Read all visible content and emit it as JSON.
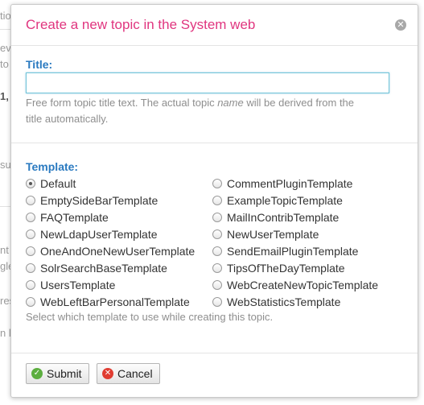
{
  "background": {
    "fragments": [
      "tio",
      "eve",
      "to",
      "1,",
      "sue",
      "nt",
      "gle",
      "res",
      "n li"
    ]
  },
  "dialog": {
    "title": "Create a new topic in the System web",
    "close_icon": "close-icon",
    "title_label": "Title:",
    "title_value": "",
    "title_hint_1": "Free form topic title text. The actual topic ",
    "title_hint_name": "name",
    "title_hint_2": " will be derived from the",
    "title_hint_3": "title automatically.",
    "template_label": "Template:",
    "templates": [
      {
        "label": "Default",
        "checked": true
      },
      {
        "label": "CommentPluginTemplate",
        "checked": false
      },
      {
        "label": "EmptySideBarTemplate",
        "checked": false
      },
      {
        "label": "ExampleTopicTemplate",
        "checked": false
      },
      {
        "label": "FAQTemplate",
        "checked": false
      },
      {
        "label": "MailInContribTemplate",
        "checked": false
      },
      {
        "label": "NewLdapUserTemplate",
        "checked": false
      },
      {
        "label": "NewUserTemplate",
        "checked": false
      },
      {
        "label": "OneAndOneNewUserTemplate",
        "checked": false
      },
      {
        "label": "SendEmailPluginTemplate",
        "checked": false
      },
      {
        "label": "SolrSearchBaseTemplate",
        "checked": false
      },
      {
        "label": "TipsOfTheDayTemplate",
        "checked": false
      },
      {
        "label": "UsersTemplate",
        "checked": false
      },
      {
        "label": "WebCreateNewTopicTemplate",
        "checked": false
      },
      {
        "label": "WebLeftBarPersonalTemplate",
        "checked": false
      },
      {
        "label": "WebStatisticsTemplate",
        "checked": false
      }
    ],
    "template_hint": "Select which template to use while creating this topic.",
    "submit_label": "Submit",
    "cancel_label": "Cancel",
    "colors": {
      "title": "#e0357f",
      "label": "#2a7ac0",
      "submit_icon": "#5cae3f",
      "cancel_icon": "#e03c31"
    }
  }
}
